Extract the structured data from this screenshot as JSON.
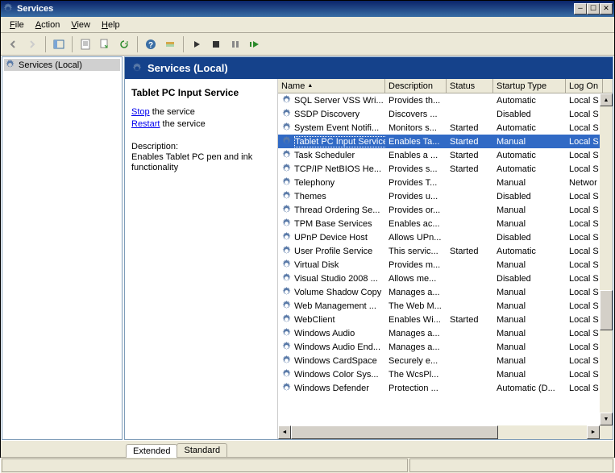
{
  "window": {
    "title": "Services"
  },
  "menu": {
    "file": "File",
    "action": "Action",
    "view": "View",
    "help": "Help"
  },
  "tree": {
    "root": "Services (Local)"
  },
  "header": {
    "title": "Services (Local)"
  },
  "detail": {
    "service_name": "Tablet PC Input Service",
    "stop_label": "Stop",
    "stop_suffix": " the service",
    "restart_label": "Restart",
    "restart_suffix": " the service",
    "desc_heading": "Description:",
    "desc_text": "Enables Tablet PC pen and ink functionality"
  },
  "columns": {
    "name": "Name",
    "description": "Description",
    "status": "Status",
    "startup": "Startup Type",
    "logon": "Log On "
  },
  "tabs": {
    "extended": "Extended",
    "standard": "Standard"
  },
  "services": [
    {
      "name": "SQL Server VSS Wri...",
      "desc": "Provides th...",
      "status": "",
      "startup": "Automatic",
      "logon": "Local S"
    },
    {
      "name": "SSDP Discovery",
      "desc": "Discovers ...",
      "status": "",
      "startup": "Disabled",
      "logon": "Local S"
    },
    {
      "name": "System Event Notifi...",
      "desc": "Monitors s...",
      "status": "Started",
      "startup": "Automatic",
      "logon": "Local S"
    },
    {
      "name": "Tablet PC Input Service",
      "desc": "Enables Ta...",
      "status": "Started",
      "startup": "Manual",
      "logon": "Local S",
      "selected": true
    },
    {
      "name": "Task Scheduler",
      "desc": "Enables a ...",
      "status": "Started",
      "startup": "Automatic",
      "logon": "Local S"
    },
    {
      "name": "TCP/IP NetBIOS He...",
      "desc": "Provides s...",
      "status": "Started",
      "startup": "Automatic",
      "logon": "Local S"
    },
    {
      "name": "Telephony",
      "desc": "Provides T...",
      "status": "",
      "startup": "Manual",
      "logon": "Networ"
    },
    {
      "name": "Themes",
      "desc": "Provides u...",
      "status": "",
      "startup": "Disabled",
      "logon": "Local S"
    },
    {
      "name": "Thread Ordering Se...",
      "desc": "Provides or...",
      "status": "",
      "startup": "Manual",
      "logon": "Local S"
    },
    {
      "name": "TPM Base Services",
      "desc": "Enables ac...",
      "status": "",
      "startup": "Manual",
      "logon": "Local S"
    },
    {
      "name": "UPnP Device Host",
      "desc": "Allows UPn...",
      "status": "",
      "startup": "Disabled",
      "logon": "Local S"
    },
    {
      "name": "User Profile Service",
      "desc": "This servic...",
      "status": "Started",
      "startup": "Automatic",
      "logon": "Local S"
    },
    {
      "name": "Virtual Disk",
      "desc": "Provides m...",
      "status": "",
      "startup": "Manual",
      "logon": "Local S"
    },
    {
      "name": "Visual Studio 2008 ...",
      "desc": "Allows me...",
      "status": "",
      "startup": "Disabled",
      "logon": "Local S"
    },
    {
      "name": "Volume Shadow Copy",
      "desc": "Manages a...",
      "status": "",
      "startup": "Manual",
      "logon": "Local S"
    },
    {
      "name": "Web Management ...",
      "desc": "The Web M...",
      "status": "",
      "startup": "Manual",
      "logon": "Local S"
    },
    {
      "name": "WebClient",
      "desc": "Enables Wi...",
      "status": "Started",
      "startup": "Manual",
      "logon": "Local S"
    },
    {
      "name": "Windows Audio",
      "desc": "Manages a...",
      "status": "",
      "startup": "Manual",
      "logon": "Local S"
    },
    {
      "name": "Windows Audio End...",
      "desc": "Manages a...",
      "status": "",
      "startup": "Manual",
      "logon": "Local S"
    },
    {
      "name": "Windows CardSpace",
      "desc": "Securely e...",
      "status": "",
      "startup": "Manual",
      "logon": "Local S"
    },
    {
      "name": "Windows Color Sys...",
      "desc": "The WcsPl...",
      "status": "",
      "startup": "Manual",
      "logon": "Local S"
    },
    {
      "name": "Windows Defender",
      "desc": "Protection ...",
      "status": "",
      "startup": "Automatic (D...",
      "logon": "Local S"
    }
  ]
}
